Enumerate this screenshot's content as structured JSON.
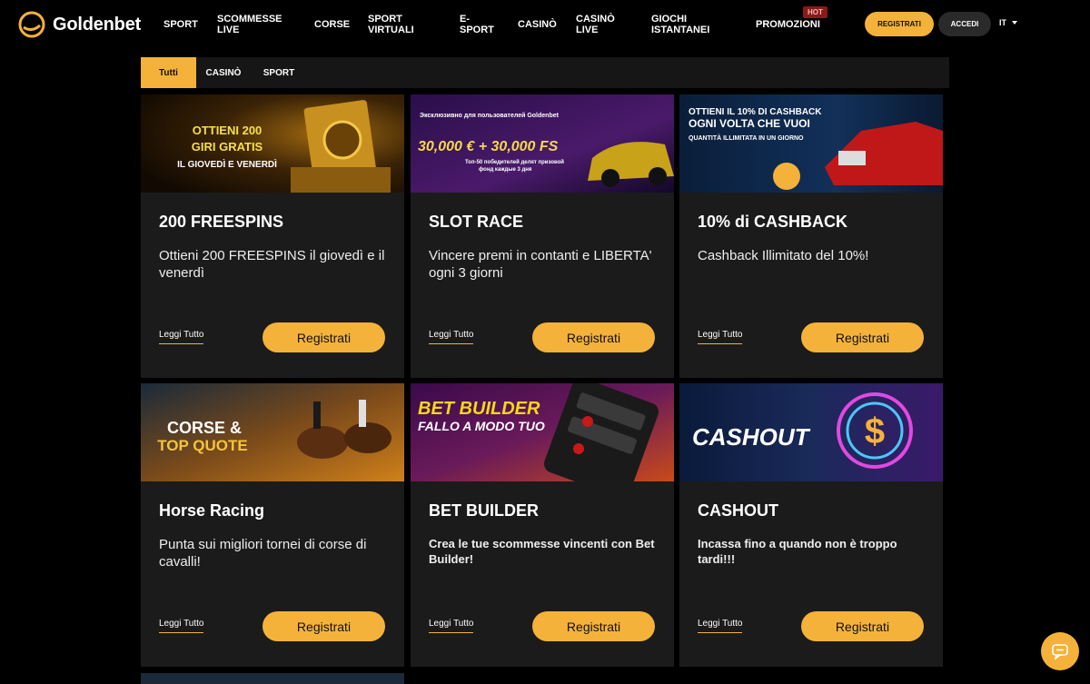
{
  "header": {
    "brand": "Goldenbet",
    "nav": [
      "SPORT",
      "SCOMMESSE LIVE",
      "CORSE",
      "SPORT VIRTUALI",
      "E-SPORT",
      "CASINÒ",
      "CASINÒ LIVE",
      "GIOCHI ISTANTANEI",
      "PROMOZIONI"
    ],
    "hot_badge": "HOT",
    "register_label": "REGISTRATI",
    "login_label": "ACCEDI",
    "language": "IT"
  },
  "filters": {
    "tabs": [
      "Tutti",
      "CASINÒ",
      "SPORT"
    ],
    "active": "Tutti"
  },
  "cards": [
    {
      "banner_lines": [
        "OTTIENI 200",
        "GIRI GRATIS",
        "IL GIOVEDÌ E VENERDÌ"
      ],
      "title": "200 FREESPINS",
      "description": "Ottieni 200 FREESPINS il giovedì e il venerdì",
      "read_more": "Leggi Tutto",
      "button": "Registrati"
    },
    {
      "banner_lines": [
        "Эксклюзивно для пользователей Goldenbet",
        "30,000 € + 30,000 FS",
        "Топ-50 победителей делят призовой",
        "фонд каждые 3 дня"
      ],
      "title": "SLOT RACE",
      "description": "Vincere premi in contanti e LIBERTA' ogni 3 giorni",
      "read_more": "Leggi Tutto",
      "button": "Registrati"
    },
    {
      "banner_lines": [
        "OTTIENI IL 10% DI CASHBACK",
        "OGNI VOLTA CHE VUOI",
        "QUANTITÀ ILLIMITATA IN UN GIORNO"
      ],
      "title": "10% di CASHBACK",
      "description": "Cashback Illimitato del 10%!",
      "read_more": "Leggi Tutto",
      "button": "Registrati"
    },
    {
      "banner_lines": [
        "CORSE &",
        "TOP QUOTE"
      ],
      "title": "Horse Racing",
      "description": "Punta sui migliori tornei di corse di cavalli!",
      "read_more": "Leggi Tutto",
      "button": "Registrati"
    },
    {
      "banner_lines": [
        "BET BUILDER",
        "FALLO A MODO TUO"
      ],
      "title": "BET BUILDER",
      "description": "Crea le tue scommesse vincenti con Bet Builder!",
      "read_more": "Leggi Tutto",
      "button": "Registrati"
    },
    {
      "banner_lines": [
        "CASHOUT"
      ],
      "title": "CASHOUT",
      "description": "Incassa fino a quando non è troppo tardi!!!",
      "read_more": "Leggi Tutto",
      "button": "Registrati"
    }
  ],
  "colors": {
    "accent": "#f5b23a",
    "background": "#000000",
    "card": "#1b1b1b"
  }
}
